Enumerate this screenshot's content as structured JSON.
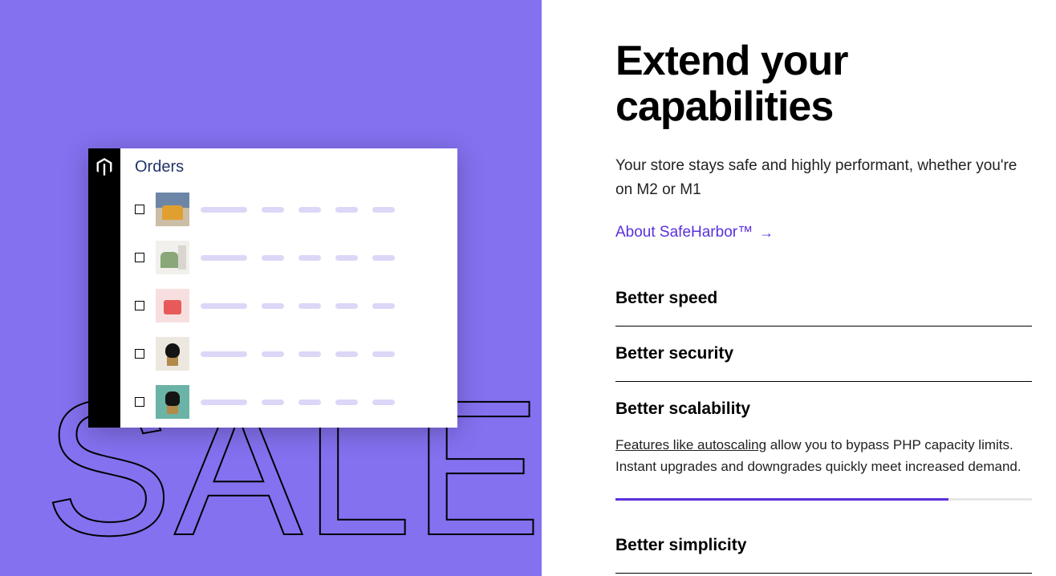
{
  "left": {
    "bg_word": "SALE",
    "orders_title": "Orders",
    "logo_name": "magento-logo-icon",
    "rows": 5
  },
  "right": {
    "headline": "Extend your capabilities",
    "subhead": "Your store stays safe and highly performant, whether you're on M2 or M1",
    "cta_label": "About SafeHarbor™",
    "accordion": [
      {
        "title": "Better speed",
        "open": false
      },
      {
        "title": "Better security",
        "open": false
      },
      {
        "title": "Better scalability",
        "open": true,
        "body_underlined": "Features like autoscaling",
        "body_rest": " allow you to bypass PHP capacity limits. Instant upgrades and downgrades quickly meet increased demand.",
        "progress_pct": 80
      },
      {
        "title": "Better simplicity",
        "open": false
      }
    ]
  },
  "colors": {
    "accent": "#5a30dc",
    "panel": "#8371ef"
  }
}
